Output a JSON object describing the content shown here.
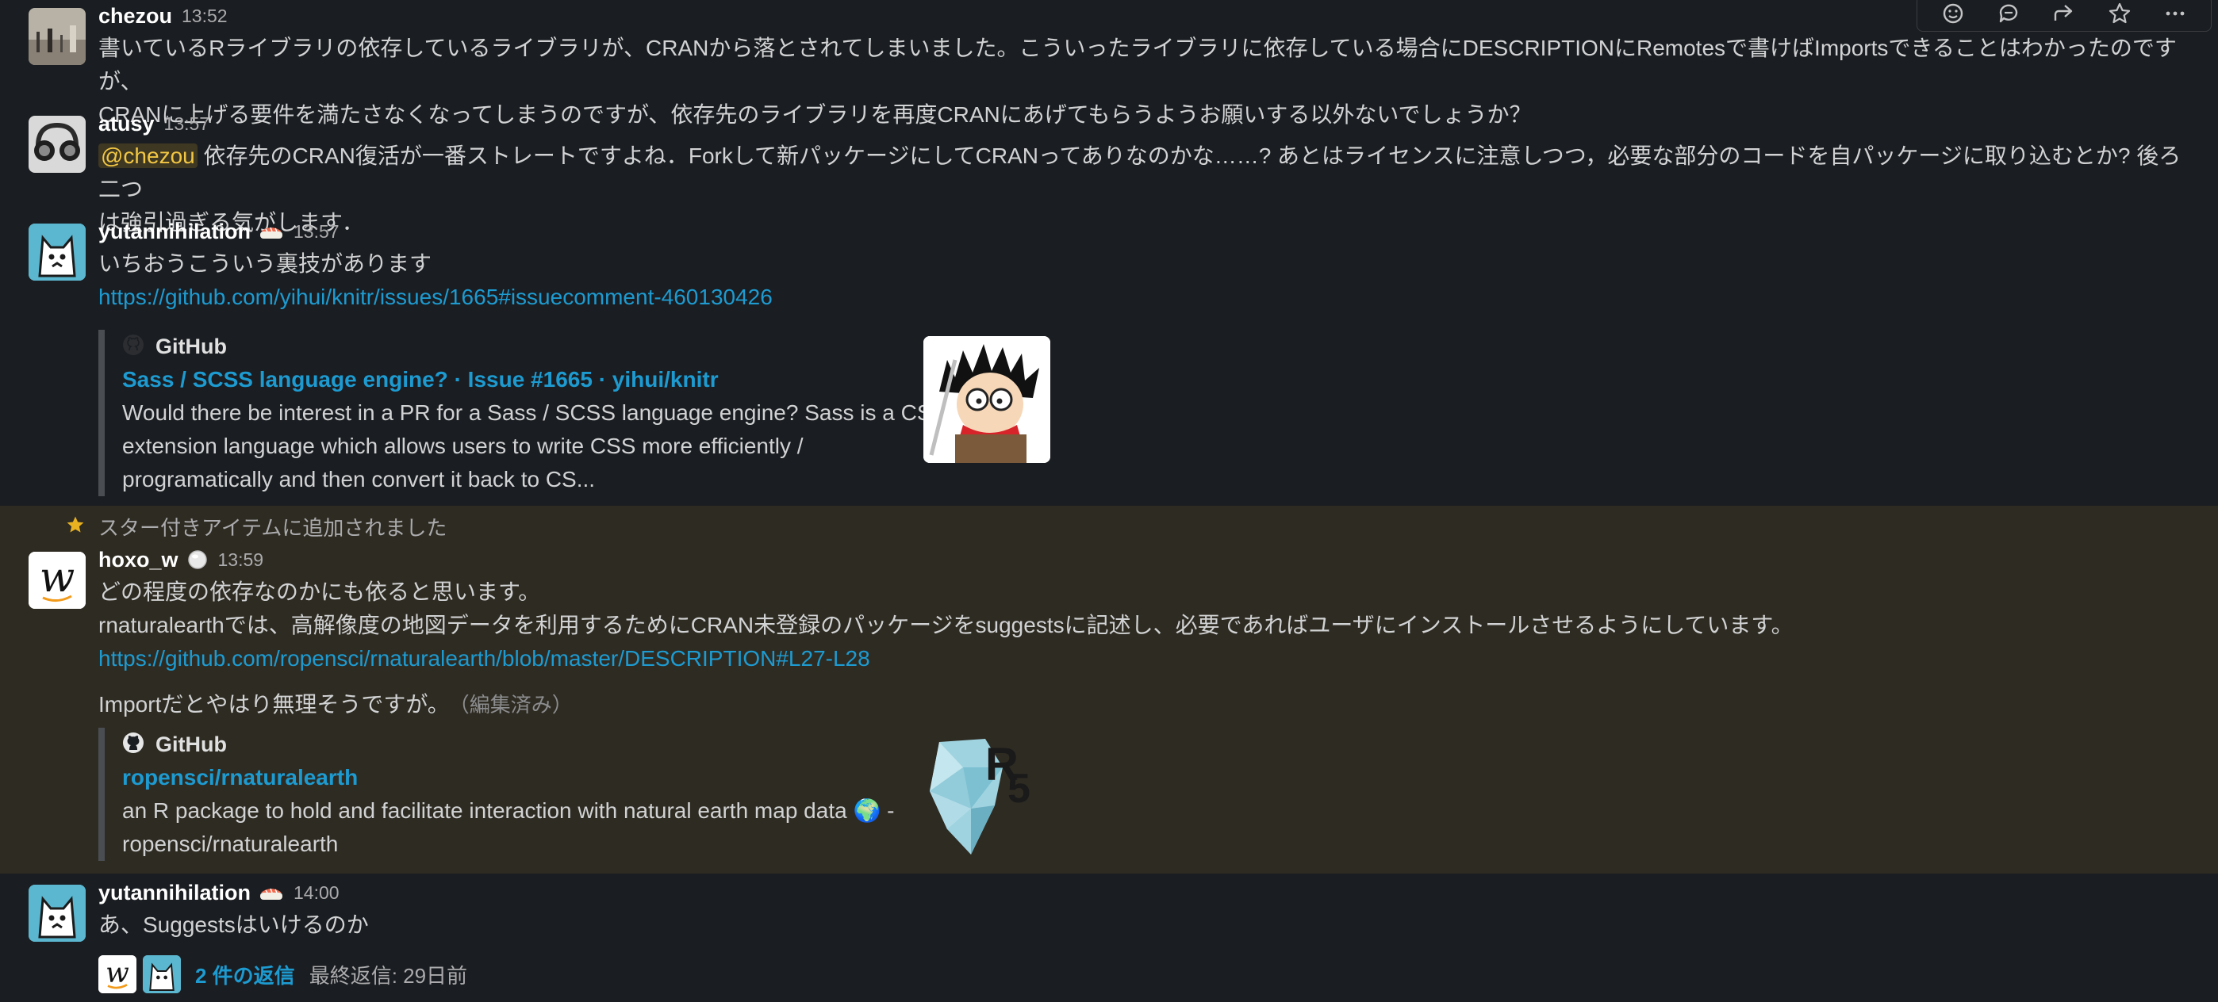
{
  "toolbar": {
    "icons": [
      "emoji-reaction-icon",
      "reply-thread-icon",
      "share-icon",
      "star-icon",
      "more-icon"
    ]
  },
  "messages": [
    {
      "user": "chezou",
      "time": "13:52",
      "lines": [
        "書いているRライブラリの依存しているライブラリが、CRANから落とされてしまいました。こういったライブラリに依存している場合にDESCRIPTIONにRemotesで書けばImportsできることはわかったのですが、",
        "CRANに上げる要件を満たさなくなってしまうのですが、依存先のライブラリを再度CRANにあげてもらうようお願いする以外ないでしょうか？"
      ]
    },
    {
      "user": "atusy",
      "time": "13:57",
      "mention": "@chezou",
      "line1": " 依存先のCRAN復活が一番ストレートですよね．Forkして新パッケージにしてCRANってありなのかな……? あとはライセンスに注意しつつ，必要な部分のコードを自パッケージに取り込むとか? 後ろ二つ",
      "line2": "は強引過ぎる気がします．"
    },
    {
      "user": "yutannihilation",
      "time": "13:57",
      "text": "いちおうこういう裏技があります",
      "link": "https://github.com/yihui/knitr/issues/1665#issuecomment-460130426",
      "unfurl": {
        "source": "GitHub",
        "title": "Sass / SCSS language engine? · Issue #1665 · yihui/knitr",
        "desc": [
          "Would there be interest in a PR for a Sass / SCSS language engine? Sass is a CSS",
          "extension language which allows users to write CSS more efficiently /",
          "programatically and then convert it back to CS..."
        ]
      }
    },
    {
      "starred_label": "スター付きアイテムに追加されました",
      "user": "hoxo_w",
      "time": "13:59",
      "line1": "どの程度の依存なのかにも依ると思います。",
      "line2": "rnaturalearthでは、高解像度の地図データを利用するためにCRAN未登録のパッケージをsuggestsに記述し、必要であればユーザにインストールさせるようにしています。",
      "link": "https://github.com/ropensci/rnaturalearth/blob/master/DESCRIPTION#L27-L28",
      "line3": "Importだとやはり無理そうですが。",
      "edited": "（編集済み）",
      "unfurl": {
        "source": "GitHub",
        "title": "ropensci/rnaturalearth",
        "desc1": "an R package to hold and facilitate interaction with natural earth map data 🌍 -",
        "desc2": "ropensci/rnaturalearth"
      }
    },
    {
      "user": "yutannihilation",
      "time": "14:00",
      "text": "あ、Suggestsはいけるのか",
      "reply_count": "2 件の返信",
      "last_reply": "最終返信: 29日前"
    }
  ]
}
